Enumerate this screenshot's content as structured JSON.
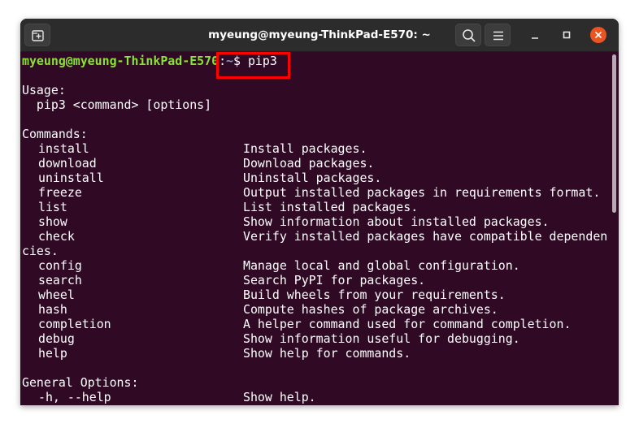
{
  "window": {
    "title": "myeung@myeung-ThinkPad-E570: ~"
  },
  "titlebar": {
    "new_tab_icon": "new-tab-icon",
    "search_icon": "search-icon",
    "menu_icon": "hamburger-menu-icon",
    "minimize_icon": "minimize-icon",
    "maximize_icon": "maximize-icon",
    "close_icon": "close-icon",
    "close_color": "#e95420"
  },
  "terminal": {
    "prompt_user": "myeung@myeung-ThinkPad-E570",
    "prompt_sep": ":",
    "prompt_path": "~",
    "prompt_dollar": "$ ",
    "command": "pip3",
    "usage_header": "Usage:",
    "usage_line": "  pip3 <command> [options]",
    "commands_header": "Commands:",
    "commands": [
      {
        "name": "install",
        "desc": "Install packages."
      },
      {
        "name": "download",
        "desc": "Download packages."
      },
      {
        "name": "uninstall",
        "desc": "Uninstall packages."
      },
      {
        "name": "freeze",
        "desc": "Output installed packages in requirements format."
      },
      {
        "name": "list",
        "desc": "List installed packages."
      },
      {
        "name": "show",
        "desc": "Show information about installed packages."
      },
      {
        "name": "check",
        "desc": "Verify installed packages have compatible dependen"
      }
    ],
    "wrap_continuation": "cies.",
    "commands2": [
      {
        "name": "config",
        "desc": "Manage local and global configuration."
      },
      {
        "name": "search",
        "desc": "Search PyPI for packages."
      },
      {
        "name": "wheel",
        "desc": "Build wheels from your requirements."
      },
      {
        "name": "hash",
        "desc": "Compute hashes of package archives."
      },
      {
        "name": "completion",
        "desc": "A helper command used for command completion."
      },
      {
        "name": "debug",
        "desc": "Show information useful for debugging."
      },
      {
        "name": "help",
        "desc": "Show help for commands."
      }
    ],
    "general_header": "General Options:",
    "general_options": [
      {
        "name": "-h, --help",
        "desc": "Show help."
      }
    ],
    "colors": {
      "background": "#300a24",
      "prompt_user": "#89e234",
      "prompt_path": "#729fcf",
      "annotation_box": "#ff0000"
    }
  }
}
